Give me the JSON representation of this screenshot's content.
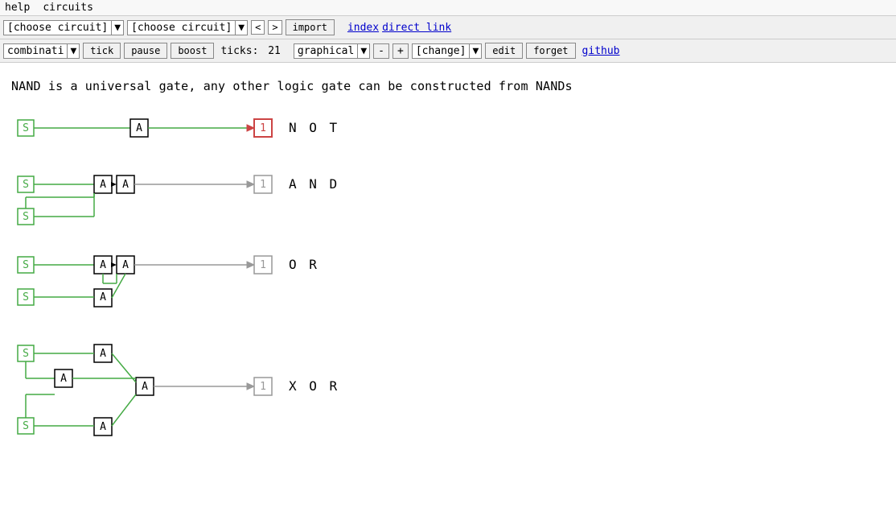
{
  "menu": {
    "help": "help",
    "circuits": "circuits"
  },
  "toolbar1": {
    "choose_circuit_1": "[choose circuit]",
    "choose_circuit_2": "[choose circuit]",
    "nav_back": "<",
    "nav_fwd": ">",
    "import_btn": "import",
    "index_link": "index",
    "direct_link_link": "direct link"
  },
  "toolbar2": {
    "combinati_btn": "combinati",
    "tick_btn": "tick",
    "pause_btn": "pause",
    "boost_btn": "boost",
    "ticks_label": "ticks:",
    "ticks_value": "21",
    "graphical_label": "graphical",
    "minus_btn": "-",
    "plus_btn": "+",
    "change_label": "[change]",
    "edit_btn": "edit",
    "forget_btn": "forget",
    "github_link": "github"
  },
  "content": {
    "intro": "NAND is a universal gate, any other logic gate can be constructed from NANDs",
    "circuits": [
      {
        "id": "NOT",
        "label": "N O T",
        "output_value": "1",
        "output_active": true
      },
      {
        "id": "AND",
        "label": "A N D",
        "output_value": "1",
        "output_active": false
      },
      {
        "id": "OR",
        "label": "O R",
        "output_value": "1",
        "output_active": false
      },
      {
        "id": "XOR",
        "label": "X O R",
        "output_value": "1",
        "output_active": false
      }
    ]
  }
}
